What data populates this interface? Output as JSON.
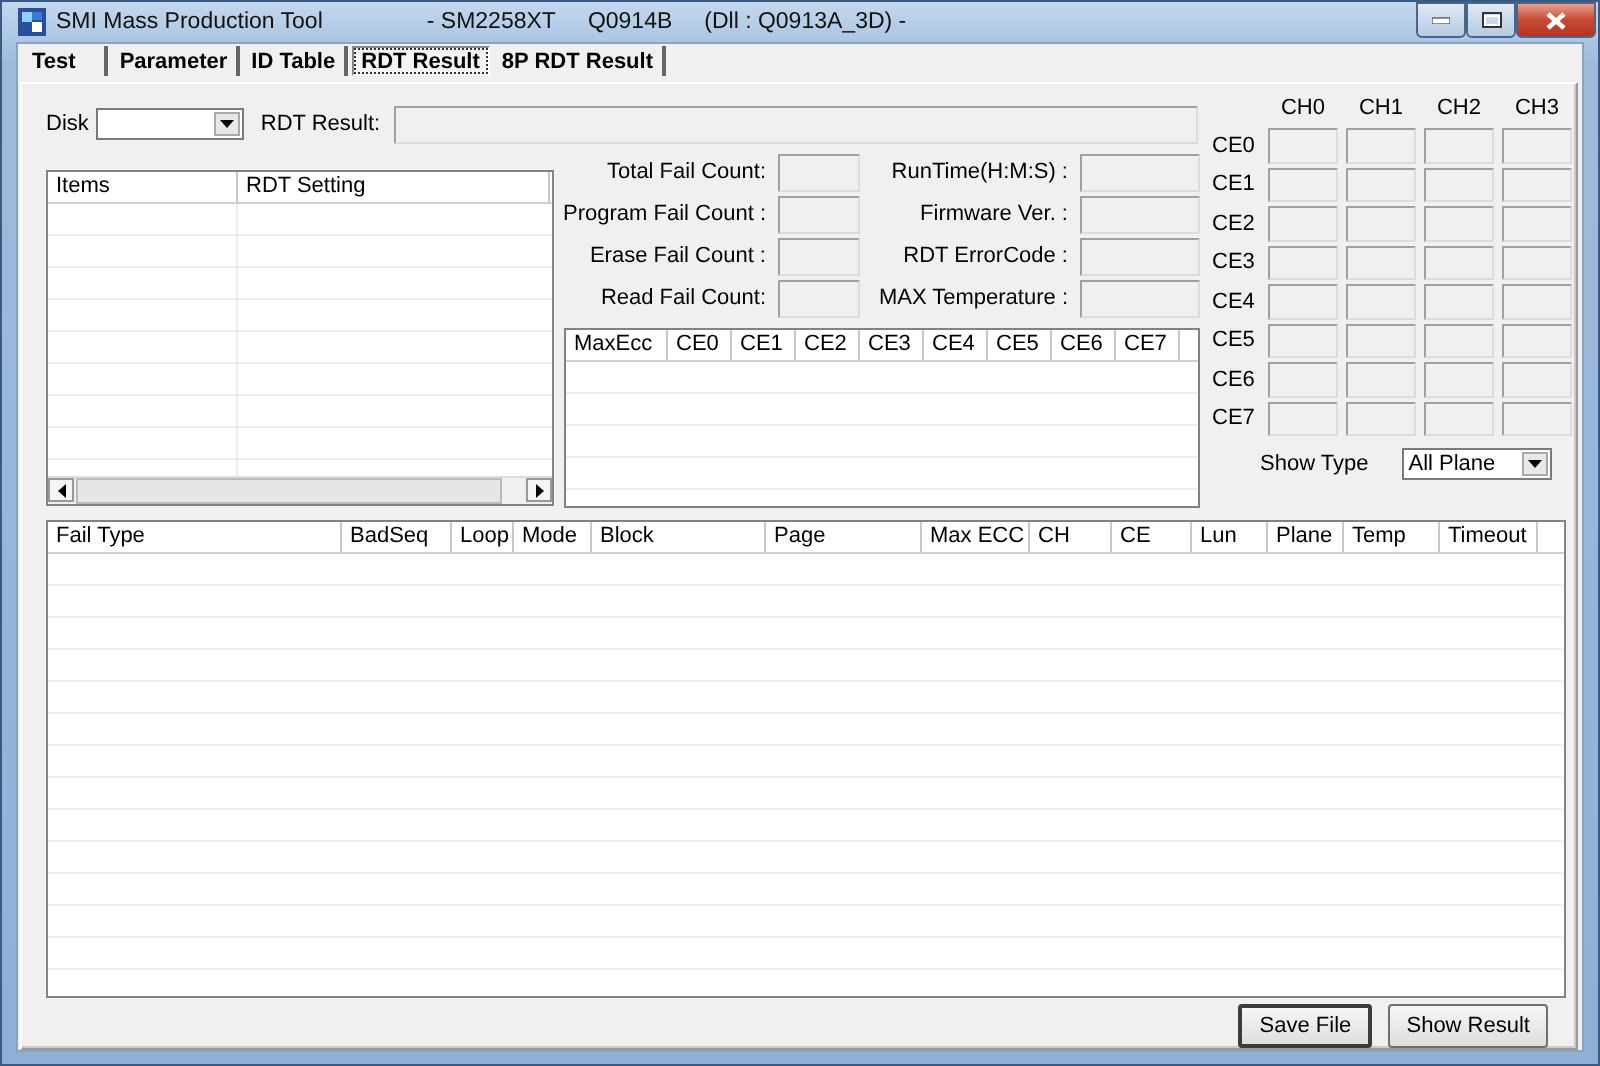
{
  "window": {
    "title_parts": [
      "SMI Mass Production Tool",
      "- SM2258XT",
      "Q0914B",
      "(Dll : Q0913A_3D) -"
    ]
  },
  "tabs": [
    {
      "label": "Test",
      "selected": false
    },
    {
      "label": "Parameter",
      "selected": false
    },
    {
      "label": "ID Table",
      "selected": false
    },
    {
      "label": "RDT Result",
      "selected": true
    },
    {
      "label": "8P RDT Result",
      "selected": false
    }
  ],
  "disk": {
    "label": "Disk"
  },
  "rdt_result": {
    "label": "RDT Result:"
  },
  "items_list": {
    "columns": [
      "Items",
      "RDT Setting"
    ]
  },
  "counts_left": [
    "Total Fail Count:",
    "Program Fail Count :",
    "Erase Fail Count :",
    "Read Fail Count:"
  ],
  "counts_right": [
    "RunTime(H:M:S) :",
    "Firmware Ver. :",
    "RDT ErrorCode :",
    "MAX Temperature :"
  ],
  "ecc_table": {
    "columns": [
      "MaxEcc",
      "CE0",
      "CE1",
      "CE2",
      "CE3",
      "CE4",
      "CE5",
      "CE6",
      "CE7"
    ]
  },
  "ch_grid": {
    "columns": [
      "CH0",
      "CH1",
      "CH2",
      "CH3"
    ],
    "rows": [
      "CE0",
      "CE1",
      "CE2",
      "CE3",
      "CE4",
      "CE5",
      "CE6",
      "CE7"
    ]
  },
  "show_type": {
    "label": "Show Type",
    "value": "All Plane"
  },
  "fail_table": {
    "columns": [
      "Fail Type",
      "BadSeq",
      "Loop",
      "Mode",
      "Block",
      "Page",
      "Max ECC",
      "CH",
      "CE",
      "Lun",
      "Plane",
      "Temp",
      "Timeout"
    ]
  },
  "buttons": [
    "Save File",
    "Show Result"
  ]
}
